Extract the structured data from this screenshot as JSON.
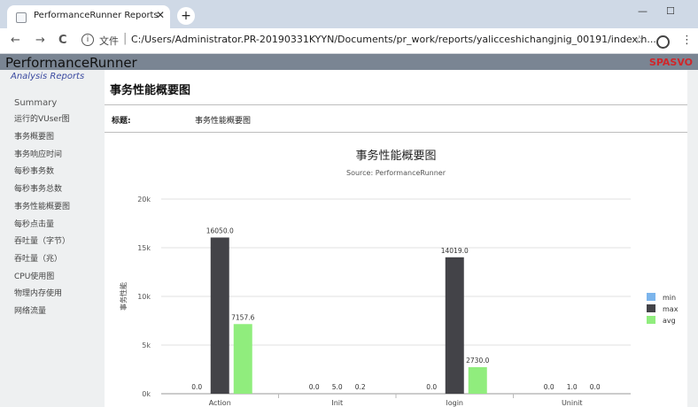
{
  "browser": {
    "tab_title": "PerformanceRunner Reports",
    "tab_close": "✕",
    "new_tab": "+",
    "window_controls": [
      "—",
      "☐"
    ],
    "nav": {
      "back": "←",
      "forward": "→",
      "reload": "C"
    },
    "scheme_label": "文件",
    "info_icon": "i",
    "address": "C:/Users/Administrator.PR-20190331KYYN/Documents/pr_work/reports/yalicceshichangjnig_00191/index.h...",
    "star": "☆",
    "menu": "⋮"
  },
  "app": {
    "title": "PerformanceRunner",
    "brand": "SPASVO",
    "header_color": "#7a8593"
  },
  "sidebar": {
    "section": "Analysis Reports",
    "summary": "Summary",
    "items": [
      "运行的VUser图",
      "事务概要图",
      "事务响应时间",
      "每秒事务数",
      "每秒事务总数",
      "事务性能概要图",
      "每秒点击量",
      "吞吐量（字节）",
      "吞吐量（兆）",
      "CPU使用图",
      "物理内存使用",
      "网络流量"
    ]
  },
  "main": {
    "heading": "事务性能概要图",
    "topic_label": "标题:",
    "topic_value": "事务性能概要图"
  },
  "chart_data": {
    "type": "bar",
    "title": "事务性能概要图",
    "subtitle": "Source: PerformanceRunner",
    "xlabel": "",
    "ylabel": "事务性能",
    "ylim": [
      0,
      20000
    ],
    "y_ticks": [
      0,
      5000,
      10000,
      15000,
      20000
    ],
    "y_tick_labels": [
      "0k",
      "5k",
      "10k",
      "15k",
      "20k"
    ],
    "categories": [
      "Action",
      "Init",
      "login",
      "Uninit"
    ],
    "series": [
      {
        "name": "min",
        "color": "#7cb5ec",
        "values": [
          0.0,
          0.0,
          0.0,
          0.0
        ],
        "labels": [
          "0.0",
          "0.0",
          "0.0",
          "0.0"
        ]
      },
      {
        "name": "max",
        "color": "#434348",
        "values": [
          16050.0,
          5.0,
          14019.0,
          1.0
        ],
        "labels": [
          "16050.0",
          "5.0",
          "14019.0",
          "1.0"
        ]
      },
      {
        "name": "avg",
        "color": "#90ed7d",
        "values": [
          7157.6,
          0.2,
          2730.0,
          0.0
        ],
        "labels": [
          "7157.6",
          "0.2",
          "2730.0",
          "0.0"
        ]
      }
    ],
    "grid": true,
    "legend_position": "right"
  }
}
